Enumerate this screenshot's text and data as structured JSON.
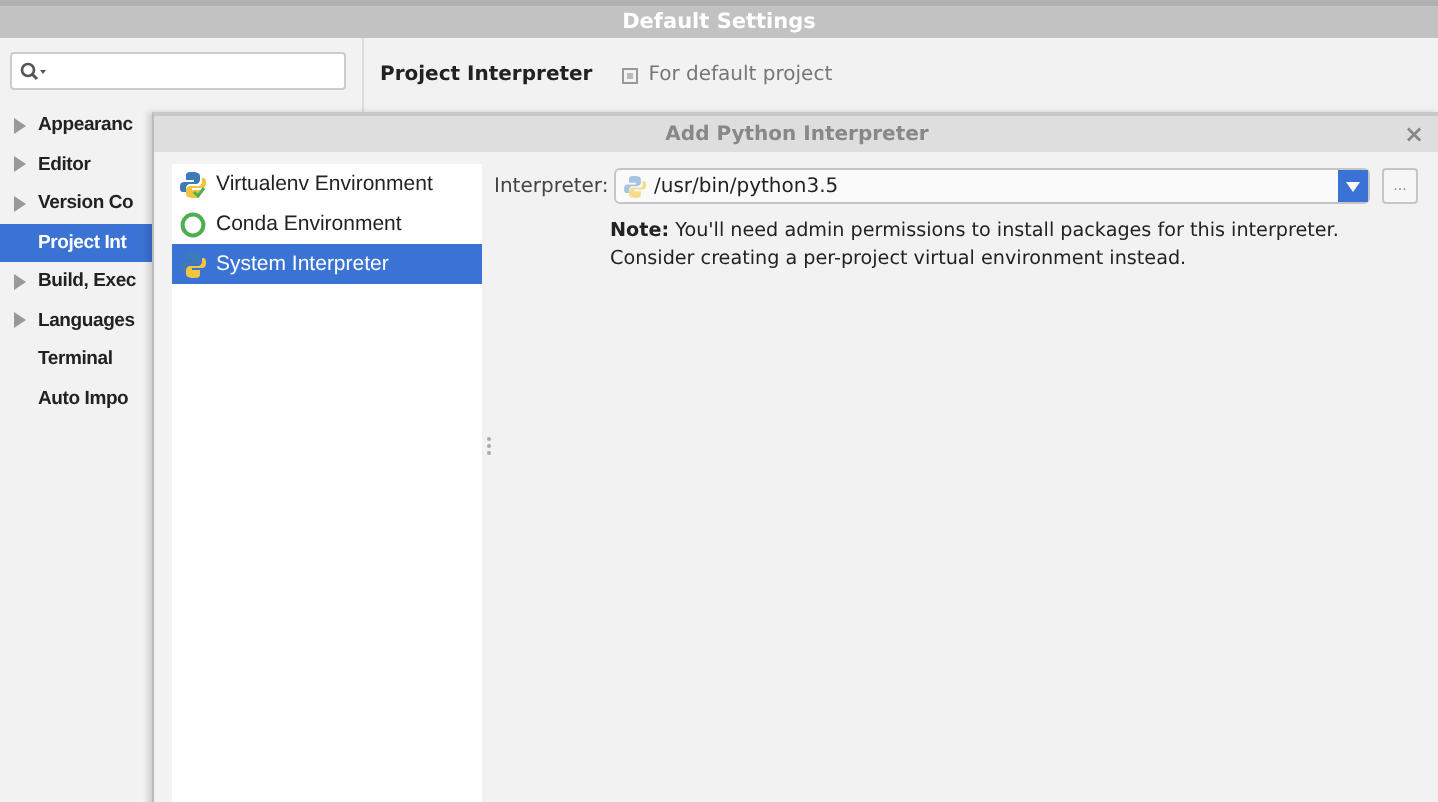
{
  "window": {
    "title": "Default Settings"
  },
  "sidebar": {
    "items": [
      {
        "label": "Appearanc",
        "expandable": true,
        "selected": false
      },
      {
        "label": "Editor",
        "expandable": true,
        "selected": false
      },
      {
        "label": "Version Co",
        "expandable": true,
        "selected": false
      },
      {
        "label": "Project Int",
        "expandable": false,
        "selected": true
      },
      {
        "label": "Build, Exec",
        "expandable": true,
        "selected": false
      },
      {
        "label": "Languages",
        "expandable": true,
        "selected": false
      },
      {
        "label": "Terminal",
        "expandable": false,
        "selected": false
      },
      {
        "label": "Auto Impo",
        "expandable": false,
        "selected": false
      }
    ]
  },
  "header": {
    "title": "Project Interpreter",
    "scope": "For default project"
  },
  "dialog": {
    "title": "Add Python Interpreter",
    "close": "×",
    "types": [
      {
        "label": "Virtualenv Environment",
        "kind": "virtualenv",
        "selected": false
      },
      {
        "label": "Conda Environment",
        "kind": "conda",
        "selected": false
      },
      {
        "label": "System Interpreter",
        "kind": "system",
        "selected": true
      }
    ],
    "interpreter_label": "Interpreter:",
    "interpreter_value": "/usr/bin/python3.5",
    "browse": "...",
    "note": "**Note:** You'll need admin permissions to install packages for this interpreter. Consider creating a per-project virtual environment instead."
  }
}
